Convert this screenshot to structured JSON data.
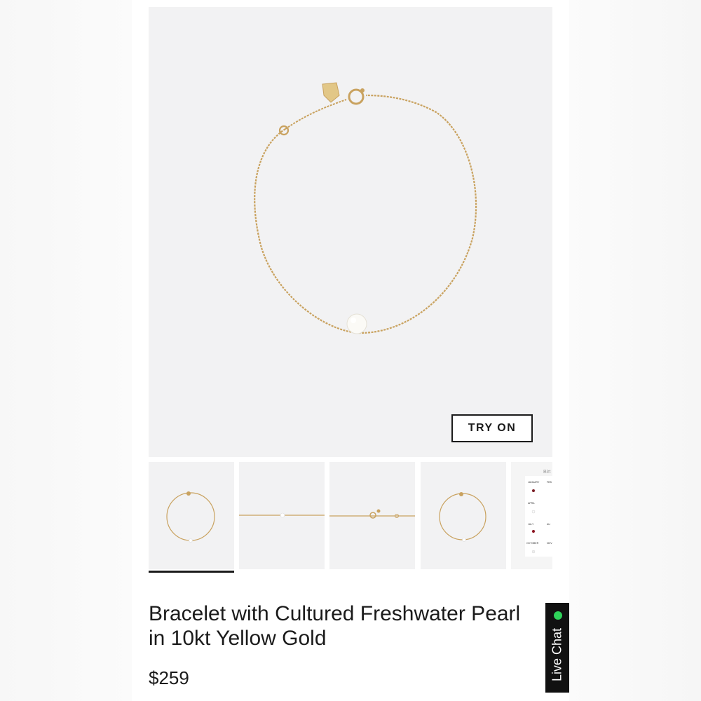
{
  "product": {
    "title_line1": "Bracelet with Cultured Freshwater Pearl",
    "title_line2": "in 10kt Yellow Gold",
    "price": "$259"
  },
  "hero": {
    "try_on_label": "TRY ON"
  },
  "thumbnails": [
    {
      "alt": "Bracelet front view",
      "active": true
    },
    {
      "alt": "Bracelet flat view"
    },
    {
      "alt": "Clasp detail"
    },
    {
      "alt": "Bracelet alternate view"
    },
    {
      "alt": "Birthstone chart"
    }
  ],
  "chart_thumb": {
    "heading": "Birt",
    "months": [
      [
        "JANUARY",
        "FEB"
      ],
      [
        "APRIL",
        ""
      ],
      [
        "JULY",
        "AU"
      ],
      [
        "OCTOBER",
        "NOV"
      ]
    ],
    "stones": [
      "GARNET",
      "WHITE SAPPHIRE",
      "RUBY",
      "OPAL"
    ]
  },
  "live_chat": {
    "label": "Live Chat",
    "status_color": "#2fd35a"
  },
  "colors": {
    "gold": "#c9a25f",
    "ink": "#1b1b1b",
    "panel": "#f2f2f3"
  }
}
